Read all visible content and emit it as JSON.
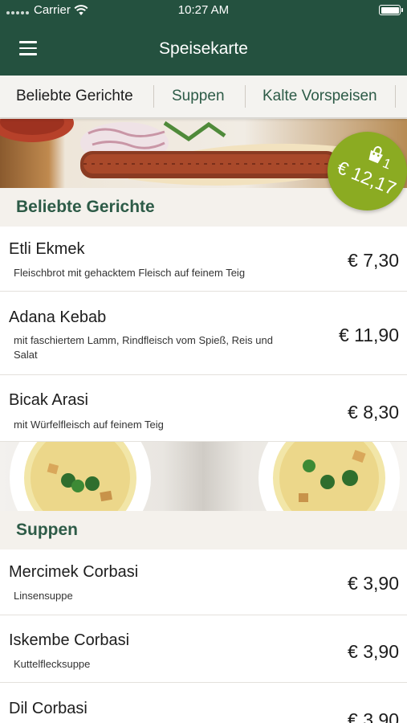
{
  "status_bar": {
    "carrier": "Carrier",
    "time": "10:27 AM"
  },
  "nav": {
    "title": "Speisekarte"
  },
  "tabs": [
    {
      "label": "Beliebte Gerichte"
    },
    {
      "label": "Suppen"
    },
    {
      "label": "Kalte Vorspeisen"
    }
  ],
  "cart": {
    "count": "1",
    "total": "€ 12,17"
  },
  "sections": [
    {
      "title": "Beliebte Gerichte",
      "items": [
        {
          "name": "Etli Ekmek",
          "description": "Fleischbrot mit gehacktem Fleisch auf feinem Teig",
          "price": "€ 7,30"
        },
        {
          "name": "Adana Kebab",
          "description": "mit faschiertem Lamm, Rindfleisch vom Spieß, Reis und Salat",
          "price": "€ 11,90"
        },
        {
          "name": "Bicak Arasi",
          "description": "mit Würfelfleisch auf feinem Teig",
          "price": "€ 8,30"
        }
      ]
    },
    {
      "title": "Suppen",
      "items": [
        {
          "name": "Mercimek Corbasi",
          "description": "Linsensuppe",
          "price": "€ 3,90"
        },
        {
          "name": "Iskembe Corbasi",
          "description": "Kuttelflecksuppe",
          "price": "€ 3,90"
        },
        {
          "name": "Dil Corbasi",
          "description": "",
          "price": "€ 3,90"
        }
      ]
    }
  ],
  "colors": {
    "primary": "#24513f",
    "accent_green": "#8bab22",
    "section_text": "#2d5b47"
  },
  "icons": {
    "menu": "menu-icon",
    "wifi": "wifi-icon",
    "battery": "battery-icon",
    "cart": "shopping-bag-icon"
  }
}
